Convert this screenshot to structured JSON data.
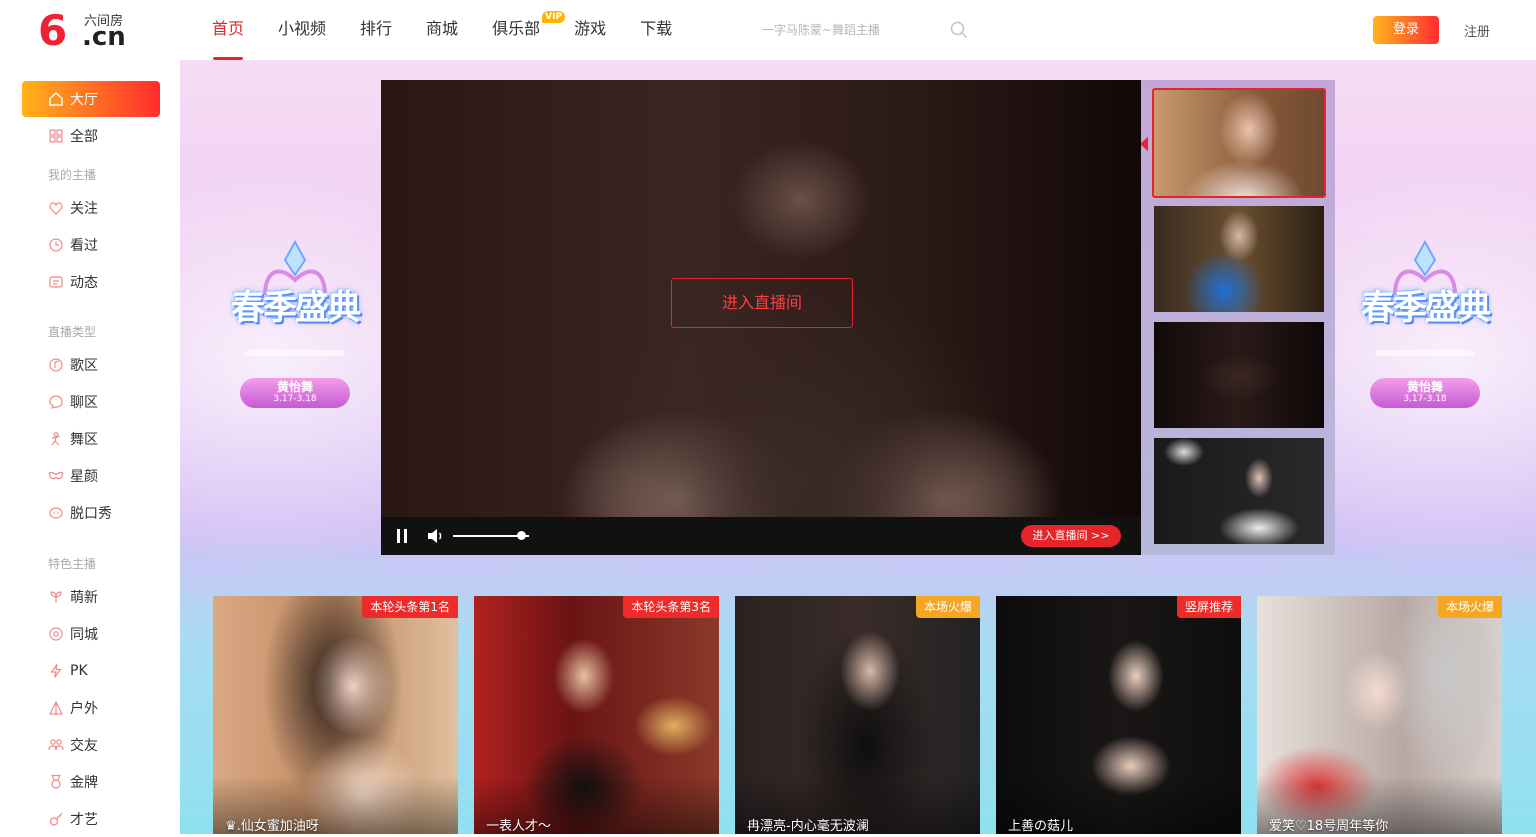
{
  "brand": {
    "logo_mark": "6",
    "name_cn": "六间房",
    "domain_suffix": ".cn",
    "accent": "#e4262a"
  },
  "nav": [
    {
      "label": "首页",
      "active": true
    },
    {
      "label": "小视频"
    },
    {
      "label": "排行"
    },
    {
      "label": "商城"
    },
    {
      "label": "俱乐部",
      "badge": "VIP"
    },
    {
      "label": "游戏"
    },
    {
      "label": "下载"
    }
  ],
  "search": {
    "placeholder": "一字马陈蒙~舞蹈主播",
    "icon": "search-icon"
  },
  "auth": {
    "login": "登录",
    "register": "注册"
  },
  "sidebar": {
    "items": [
      {
        "label": "大厅",
        "icon": "home-icon",
        "active": true
      },
      {
        "label": "全部",
        "icon": "grid-icon"
      }
    ],
    "my_heading": "我的主播",
    "my_items": [
      {
        "label": "关注",
        "icon": "heart-icon"
      },
      {
        "label": "看过",
        "icon": "clock-icon"
      },
      {
        "label": "动态",
        "icon": "feed-icon"
      }
    ],
    "type_heading": "直播类型",
    "type_items": [
      {
        "label": "歌区",
        "icon": "music-icon"
      },
      {
        "label": "聊区",
        "icon": "chat-icon"
      },
      {
        "label": "舞区",
        "icon": "dance-icon"
      },
      {
        "label": "星颜",
        "icon": "mask-icon"
      },
      {
        "label": "脱口秀",
        "icon": "mic-icon"
      }
    ],
    "feature_heading": "特色主播",
    "feature_items": [
      {
        "label": "萌新",
        "icon": "sprout-icon"
      },
      {
        "label": "同城",
        "icon": "location-icon"
      },
      {
        "label": "PK",
        "icon": "lightning-icon"
      },
      {
        "label": "户外",
        "icon": "tent-icon"
      },
      {
        "label": "交友",
        "icon": "friends-icon"
      },
      {
        "label": "金牌",
        "icon": "medal-icon"
      },
      {
        "label": "才艺",
        "icon": "guitar-icon"
      }
    ]
  },
  "banner": {
    "title": "春季盛典",
    "pill_name": "黄怡舞",
    "pill_date": "3.17-3.18"
  },
  "player": {
    "enter_room": "进入直播间",
    "enter_room_small": "进入直播间 >>",
    "volume_level": 0.9
  },
  "cards": [
    {
      "tag": "本轮头条第1名",
      "tag_color": "red",
      "name": "♛.仙女蜜加油呀"
    },
    {
      "tag": "本轮头条第3名",
      "tag_color": "red",
      "name": "一表人才～"
    },
    {
      "tag": "本场火爆",
      "tag_color": "orange",
      "name": "冉漂亮-内心毫无波澜"
    },
    {
      "tag": "竖屏推荐",
      "tag_color": "red",
      "name": "上善の菇儿"
    },
    {
      "tag": "本场火爆",
      "tag_color": "orange",
      "name": "爱笑♡18号周年等你"
    }
  ]
}
